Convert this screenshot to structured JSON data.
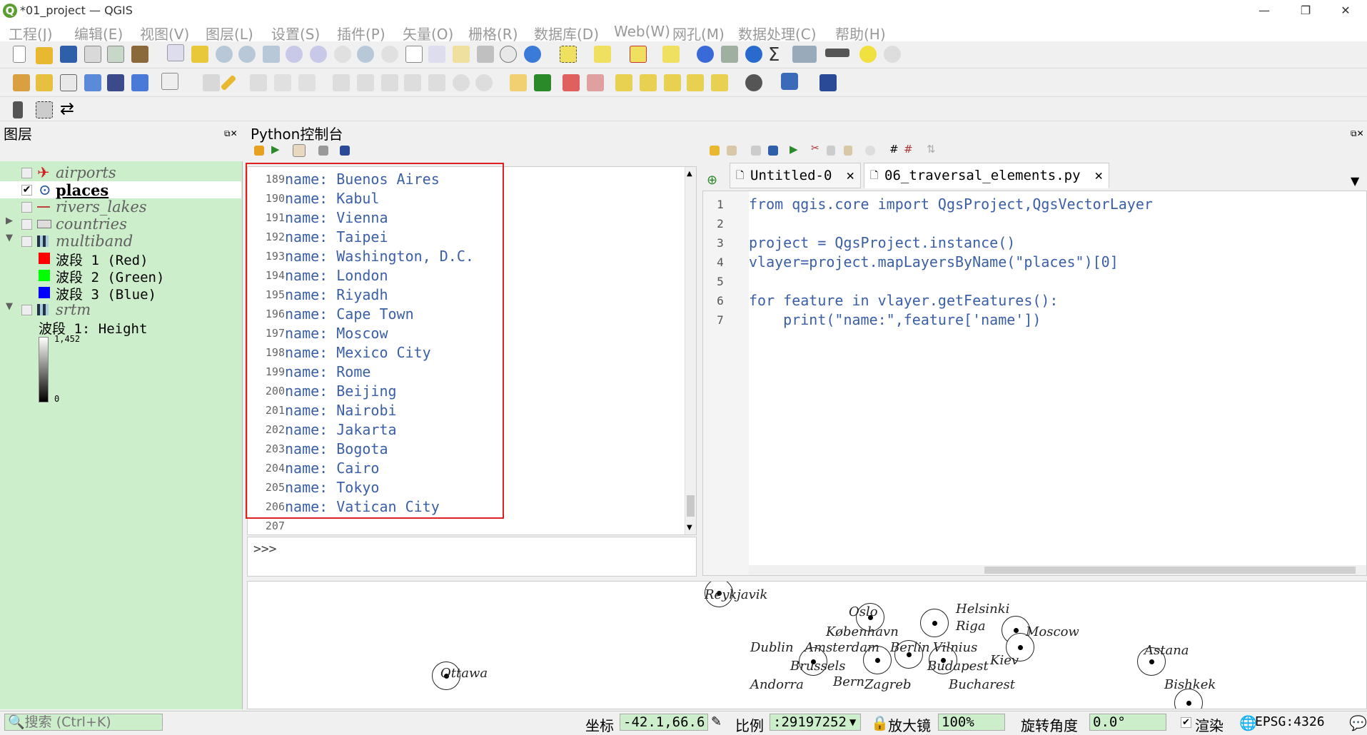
{
  "window": {
    "title": "*01_project — QGIS",
    "min": "—",
    "max": "❐",
    "close": "✕"
  },
  "menu": [
    "工程(J)",
    "编辑(E)",
    "视图(V)",
    "图层(L)",
    "设置(S)",
    "插件(P)",
    "矢量(O)",
    "栅格(R)",
    "数据库(D)",
    "Web(W)",
    "网孔(M)",
    "数据处理(C)",
    "帮助(H)"
  ],
  "layers_panel": {
    "title": "图层",
    "layers": [
      {
        "name": "airports",
        "checked": false
      },
      {
        "name": "places",
        "checked": true
      },
      {
        "name": "rivers_lakes",
        "checked": false
      },
      {
        "name": "countries",
        "checked": false
      },
      {
        "name": "multiband",
        "checked": false
      },
      {
        "name": "srtm",
        "checked": false
      }
    ],
    "bands": [
      {
        "label": "波段 1 (Red)",
        "color": "#ff0000"
      },
      {
        "label": "波段 2 (Green)",
        "color": "#00ff00"
      },
      {
        "label": "波段 3 (Blue)",
        "color": "#0000ff"
      }
    ],
    "srtm_band": "波段 1: Height",
    "srtm_max": "1,452",
    "srtm_min": "0"
  },
  "python_console": {
    "title": "Python控制台",
    "prompt": ">>>",
    "output": [
      {
        "n": "189",
        "t": "name: Buenos Aires"
      },
      {
        "n": "190",
        "t": "name: Kabul"
      },
      {
        "n": "191",
        "t": "name: Vienna"
      },
      {
        "n": "192",
        "t": "name: Taipei"
      },
      {
        "n": "193",
        "t": "name: Washington, D.C."
      },
      {
        "n": "194",
        "t": "name: London"
      },
      {
        "n": "195",
        "t": "name: Riyadh"
      },
      {
        "n": "196",
        "t": "name: Cape Town"
      },
      {
        "n": "197",
        "t": "name: Moscow"
      },
      {
        "n": "198",
        "t": "name: Mexico City"
      },
      {
        "n": "199",
        "t": "name: Rome"
      },
      {
        "n": "200",
        "t": "name: Beijing"
      },
      {
        "n": "201",
        "t": "name: Nairobi"
      },
      {
        "n": "202",
        "t": "name: Jakarta"
      },
      {
        "n": "203",
        "t": "name: Bogota"
      },
      {
        "n": "204",
        "t": "name: Cairo"
      },
      {
        "n": "205",
        "t": "name: Tokyo"
      },
      {
        "n": "206",
        "t": "name: Vatican City"
      },
      {
        "n": "207",
        "t": ""
      }
    ]
  },
  "editor": {
    "tabs": [
      "Untitled-0",
      "06_traversal_elements.py"
    ],
    "lines": [
      {
        "n": "1",
        "t": "from qgis.core import QgsProject,QgsVectorLayer"
      },
      {
        "n": "2",
        "t": ""
      },
      {
        "n": "3",
        "t": "project = QgsProject.instance()"
      },
      {
        "n": "4",
        "t": "vlayer=project.mapLayersByName(\"places\")[0]"
      },
      {
        "n": "5",
        "t": ""
      },
      {
        "n": "6",
        "t": "for feature in vlayer.getFeatures():"
      },
      {
        "n": "7",
        "t": "    print(\"name:\",feature['name'])"
      }
    ]
  },
  "map_labels": [
    "Reykjavik",
    "Oslo",
    "Helsinki",
    "Riga",
    "Moscow",
    "København",
    "Dublin",
    "Amsterdam",
    "Berlin",
    "Vilnius",
    "Brussels",
    "Budapest",
    "Kiev",
    "Astana",
    "Ottawa",
    "Andorra",
    "Bern",
    "Zagreb",
    "Bucharest",
    "Bishkek"
  ],
  "status": {
    "search_placeholder": "搜索 (Ctrl+K)",
    "coord_label": "坐标",
    "coord_value": "-42.1,66.6",
    "scale_label": "比例",
    "scale_value": ":29197252",
    "magnifier_label": "放大镜",
    "magnifier_value": "100%",
    "rotation_label": "旋转角度",
    "rotation_value": "0.0°",
    "render_label": "渲染",
    "crs": "EPSG:4326"
  }
}
